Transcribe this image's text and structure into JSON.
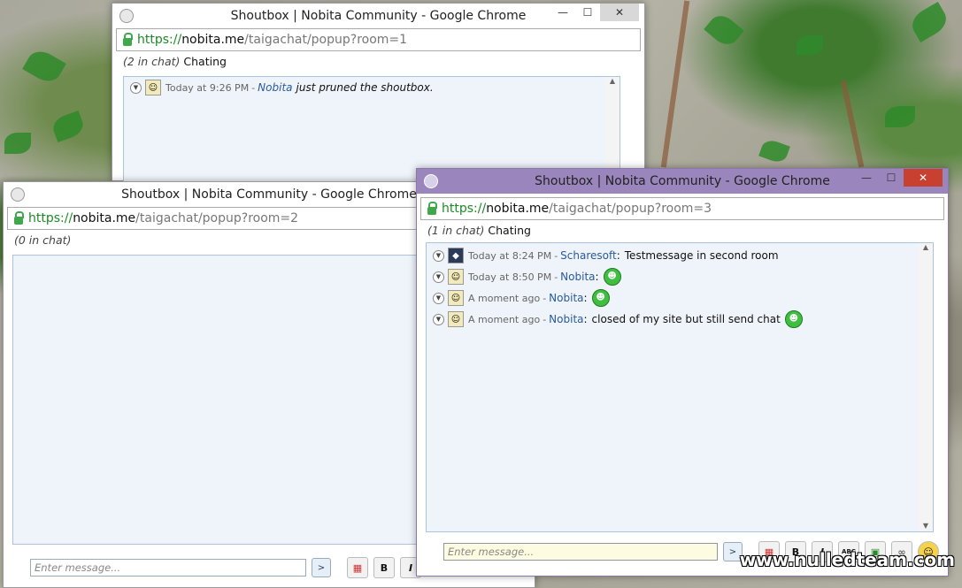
{
  "windows": [
    {
      "id": "room1",
      "title": "Shoutbox | Nobita Community - Google Chrome",
      "url": {
        "scheme": "https://",
        "host": "nobita.me",
        "path": "/taigachat/popup?room=1"
      },
      "chat_count": "(2 in chat)",
      "chat_status": "Chating",
      "messages": [
        {
          "time": "Today at 9:26 PM",
          "user": "Nobita",
          "text": "just pruned the shoutbox."
        }
      ]
    },
    {
      "id": "room2",
      "title": "Shoutbox | Nobita Community - Google Chrome",
      "url": {
        "scheme": "https://",
        "host": "nobita.me",
        "path": "/taigachat/popup?room=2"
      },
      "chat_count": "(0 in chat)",
      "input_placeholder": "Enter message..."
    },
    {
      "id": "room3",
      "title": "Shoutbox | Nobita Community - Google Chrome",
      "url": {
        "scheme": "https://",
        "host": "nobita.me",
        "path": "/taigachat/popup?room=3"
      },
      "chat_count": "(1 in chat)",
      "chat_status": "Chating",
      "messages": [
        {
          "time": "Today at 8:24 PM",
          "user": "Scharesoft",
          "text": "Testmessage in second room"
        },
        {
          "time": "Today at 8:50 PM",
          "user": "Nobita",
          "text": ""
        },
        {
          "time": "A moment ago",
          "user": "Nobita",
          "text": ""
        },
        {
          "time": "A moment ago",
          "user": "Nobita",
          "text": "closed of my site but still send chat"
        }
      ],
      "input_placeholder": "Enter message..."
    }
  ],
  "toolbar": {
    "bold_label": "B",
    "italic_label": "I",
    "abc_label": "ABC"
  },
  "watermark": "www.nulledteam.com",
  "colors": {
    "active_titlebar": "#9a86bd",
    "close_button": "#c8402f",
    "url_green": "#1b8a25",
    "username_blue": "#2a5a9a"
  },
  "icons": [
    "chrome-icon",
    "lock-icon",
    "collapse-icon",
    "avatar-icon",
    "grin-smiley-icon",
    "send-icon",
    "color-palette-icon",
    "minimize-icon",
    "maximize-icon",
    "close-icon"
  ]
}
